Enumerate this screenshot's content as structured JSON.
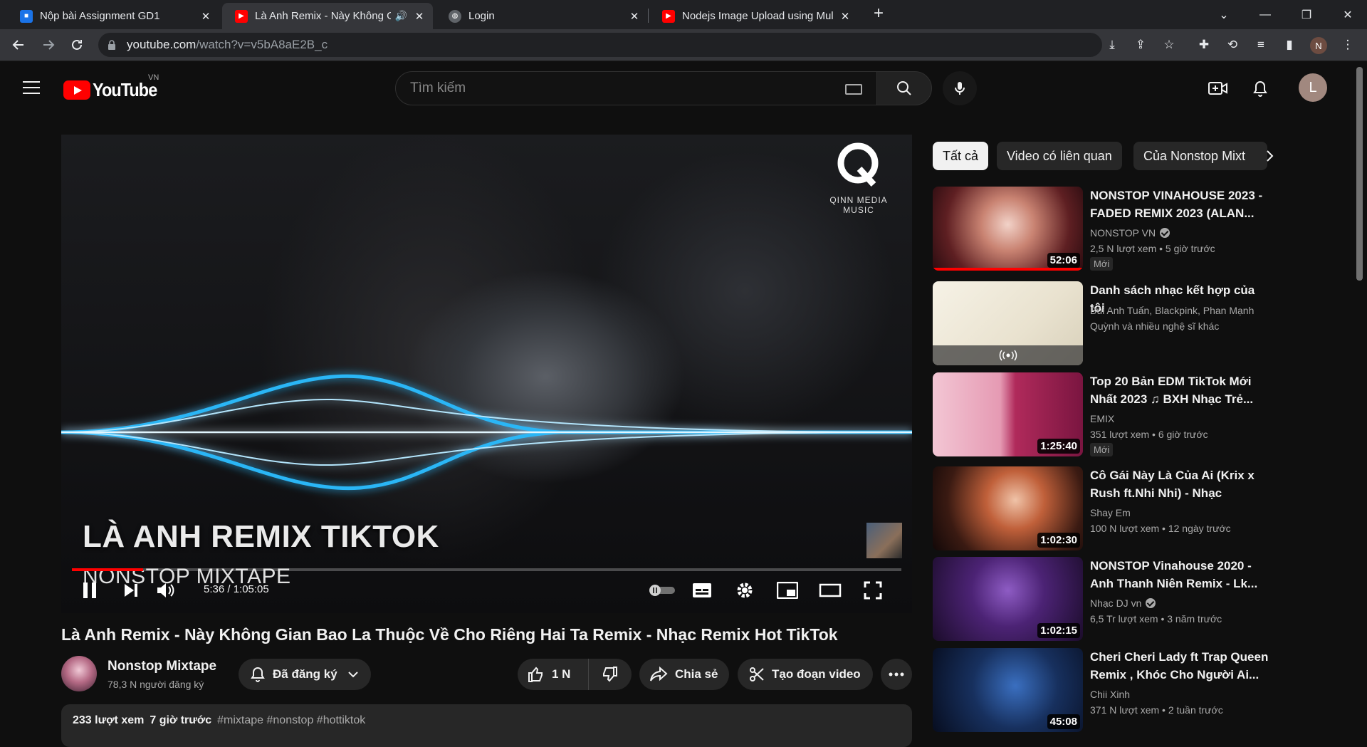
{
  "browser": {
    "tabs": [
      {
        "title": "Nộp bài Assignment GD1",
        "active": false
      },
      {
        "title": "Là Anh Remix - Này Không G",
        "active": true
      },
      {
        "title": "Login",
        "active": false
      },
      {
        "title": "Nodejs Image Upload using Mul",
        "active": false
      }
    ],
    "url_host": "youtube.com",
    "url_path": "/watch?v=v5bA8aE2B_c",
    "profile_initial": "N"
  },
  "youtube": {
    "logo_text": "YouTube",
    "country_code": "VN",
    "search_placeholder": "Tìm kiếm",
    "avatar_initial": "L"
  },
  "player": {
    "overlay_title": "LÀ ANH REMIX TIKTOK",
    "overlay_subtitle": "NONSTOP MIXTAPE",
    "brand_text": "QINN MEDIA MUSIC",
    "time": "5:36 / 1:05:05",
    "progress": 0.086
  },
  "video": {
    "title": "Là Anh Remix - Này Không Gian Bao La Thuộc Về Cho Riêng Hai Ta Remix - Nhạc Remix Hot TikTok",
    "channel_name": "Nonstop Mixtape",
    "subscribers": "78,3 N người đăng ký",
    "subscribed_label": "Đã đăng ký",
    "likes": "1 N",
    "share_label": "Chia sẻ",
    "clip_label": "Tạo đoạn video",
    "views": "233 lượt xem",
    "posted": "7 giờ trước",
    "hashtags": "#mixtape #nonstop #hottiktok"
  },
  "chips": [
    "Tất cả",
    "Video có liên quan",
    "Của Nonstop Mixt"
  ],
  "recommendations": [
    {
      "title": "NONSTOP VINAHOUSE 2023 - FADED REMIX 2023 (ALAN...",
      "channel": "NONSTOP VN",
      "verified": true,
      "meta": "2,5 N lượt xem  • 5 giờ trước",
      "duration": "52:06",
      "badge": "Mới",
      "watched": 1.0
    },
    {
      "title": "Danh sách nhạc kết hợp của tôi",
      "channel": "Bùi Anh Tuấn, Blackpink, Phan Mạnh",
      "verified": false,
      "meta": "Quỳnh và nhiều nghệ sĩ khác",
      "duration": "",
      "badge": "",
      "watched": 0
    },
    {
      "title": "Top 20 Bản EDM TikTok Mới Nhất 2023 ♫ BXH Nhạc Trẻ...",
      "channel": "EMIX",
      "verified": false,
      "meta": "351 lượt xem  • 6 giờ trước",
      "duration": "1:25:40",
      "badge": "Mới",
      "watched": 0
    },
    {
      "title": "Cô Gái Này Là Của Ai (Krix x Rush ft.Nhi Nhi) - Nhạc Remix...",
      "channel": "Shay Em",
      "verified": false,
      "meta": "100 N lượt xem  • 12 ngày trước",
      "duration": "1:02:30",
      "badge": "",
      "watched": 0
    },
    {
      "title": "NONSTOP Vinahouse 2020 - Anh Thanh Niên Remix - Lk...",
      "channel": "Nhạc DJ vn",
      "verified": true,
      "meta": "6,5 Tr lượt xem  • 3 năm trước",
      "duration": "1:02:15",
      "badge": "",
      "watched": 0
    },
    {
      "title": "Cheri Cheri Lady ft Trap Queen Remix , Khóc Cho Người Ai...",
      "channel": "Chii Xinh",
      "verified": false,
      "meta": "371 N lượt xem  • 2 tuần trước",
      "duration": "45:08",
      "badge": "",
      "watched": 0
    }
  ],
  "colors": {
    "accent": "#ff0000",
    "background": "#0f0f0f",
    "chip": "#272727"
  }
}
